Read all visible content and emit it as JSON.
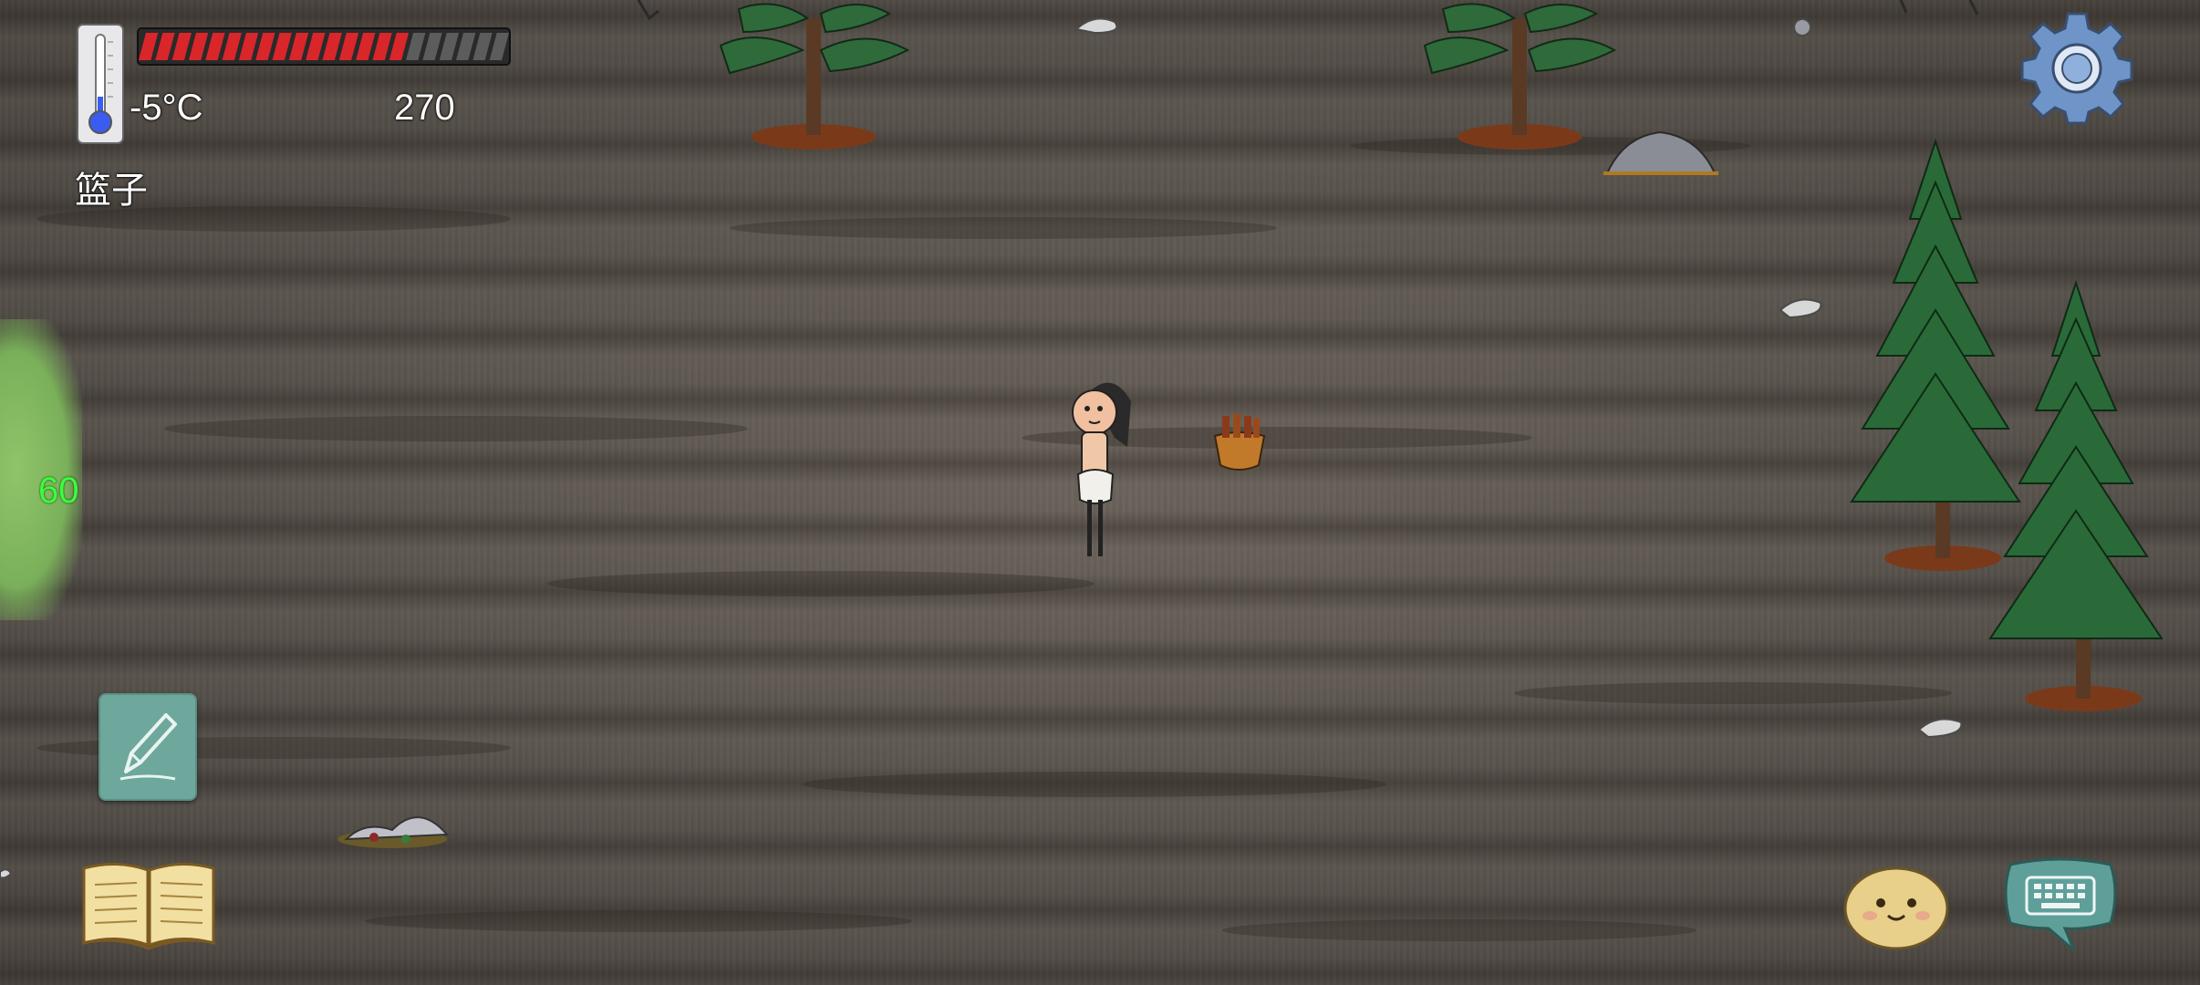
{
  "hud": {
    "temperature": "-5°C",
    "score": "270",
    "held_item": "篮子",
    "fps": "60",
    "food_meter": {
      "filled": 16,
      "total": 22
    }
  },
  "colors": {
    "food_filled": "#d9262b",
    "food_empty": "#5c5c5c",
    "fps_text": "#3cff3c",
    "thermometer_bulb": "#3a5cf0",
    "note_button": "#6ea79b",
    "chat_bubble": "#5f9f9a",
    "ground": "#5a534c"
  },
  "icons": {
    "settings": "gear-icon",
    "note": "pencil-icon",
    "book": "open-book-icon",
    "emote": "smiley-face-icon",
    "chat": "keyboard-chat-icon",
    "thermometer": "thermometer-icon"
  }
}
